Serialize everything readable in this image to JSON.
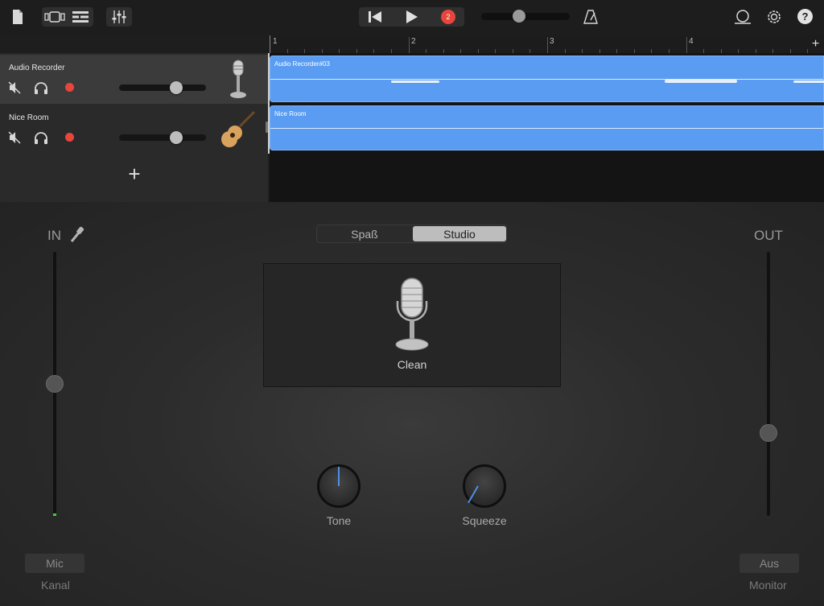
{
  "toolbar": {
    "icons": [
      "document-icon",
      "view-toggle-icon",
      "tracks-view-icon",
      "mixer-icon",
      "rewind-icon",
      "play-icon",
      "record-icon",
      "metronome-icon",
      "loop-icon",
      "settings-icon",
      "help-icon"
    ],
    "record_count": "2",
    "help_label": "?",
    "master_volume": 0.41
  },
  "ruler": {
    "bars": [
      "1",
      "2",
      "3",
      "4"
    ],
    "add_label": "+"
  },
  "tracks": [
    {
      "name": "Audio Recorder",
      "volume": 0.68,
      "instrument_icon": "microphone-icon",
      "region": "Audio Recorder#03"
    },
    {
      "name": "Nice Room",
      "volume": 0.68,
      "instrument_icon": "guitar-icon",
      "region": "Nice Room"
    }
  ],
  "add_track_label": "+",
  "panel": {
    "in_label": "IN",
    "out_label": "OUT",
    "segments": [
      "Spaß",
      "Studio"
    ],
    "selected_segment": "Studio",
    "preset_name": "Clean",
    "knobs": [
      {
        "label": "Tone"
      },
      {
        "label": "Squeeze"
      }
    ],
    "in_level": 0.5,
    "out_level": 0.3,
    "channel_value": "Mic",
    "channel_label": "Kanal",
    "monitor_value": "Aus",
    "monitor_label": "Monitor"
  },
  "colors": {
    "accent": "#5a9cf1",
    "record": "#e8453c",
    "background": "#1e1e1e"
  }
}
